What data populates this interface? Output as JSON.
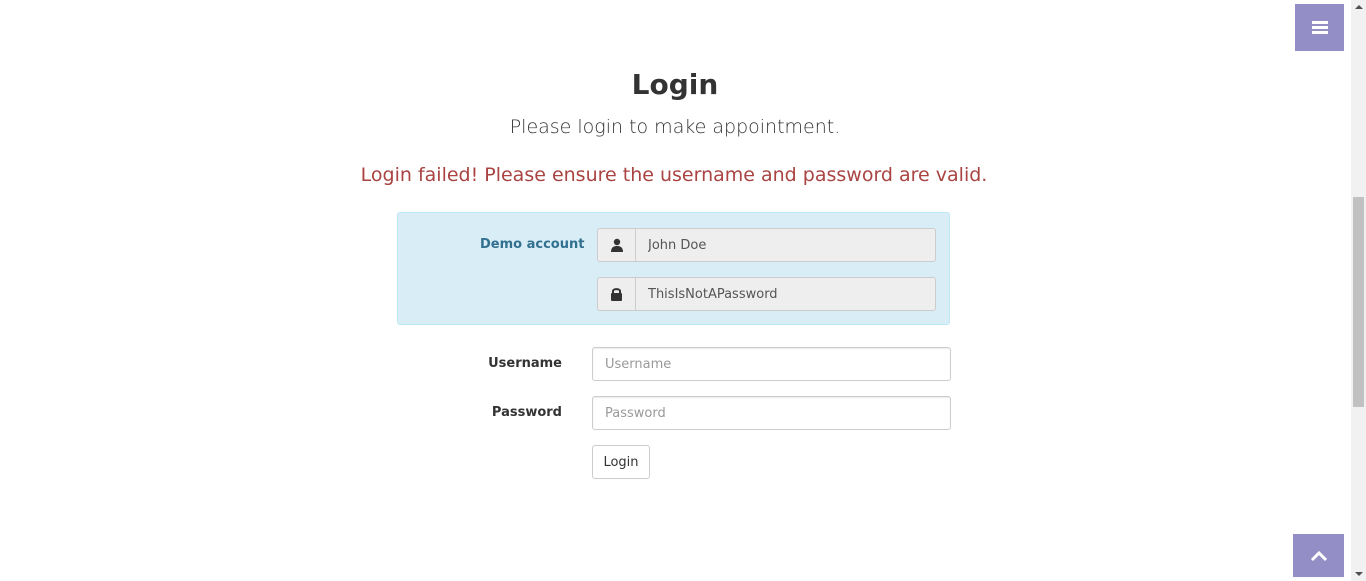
{
  "page": {
    "title": "Login",
    "subtitle": "Please login to make appointment.",
    "error": "Login failed! Please ensure the username and password are valid."
  },
  "demo": {
    "label": "Demo account",
    "username": "John Doe",
    "password": "ThisIsNotAPassword",
    "user_icon": "user-icon",
    "lock_icon": "lock-icon"
  },
  "form": {
    "username_label": "Username",
    "username_placeholder": "Username",
    "username_value": "",
    "password_label": "Password",
    "password_placeholder": "Password",
    "password_value": "",
    "login_button": "Login"
  },
  "controls": {
    "menu_icon": "hamburger-menu-icon",
    "to_top_icon": "chevron-up-icon"
  },
  "colors": {
    "accent": "#938ec6",
    "error": "#a94442",
    "info_bg": "#d9edf7",
    "info_text": "#31708f"
  }
}
